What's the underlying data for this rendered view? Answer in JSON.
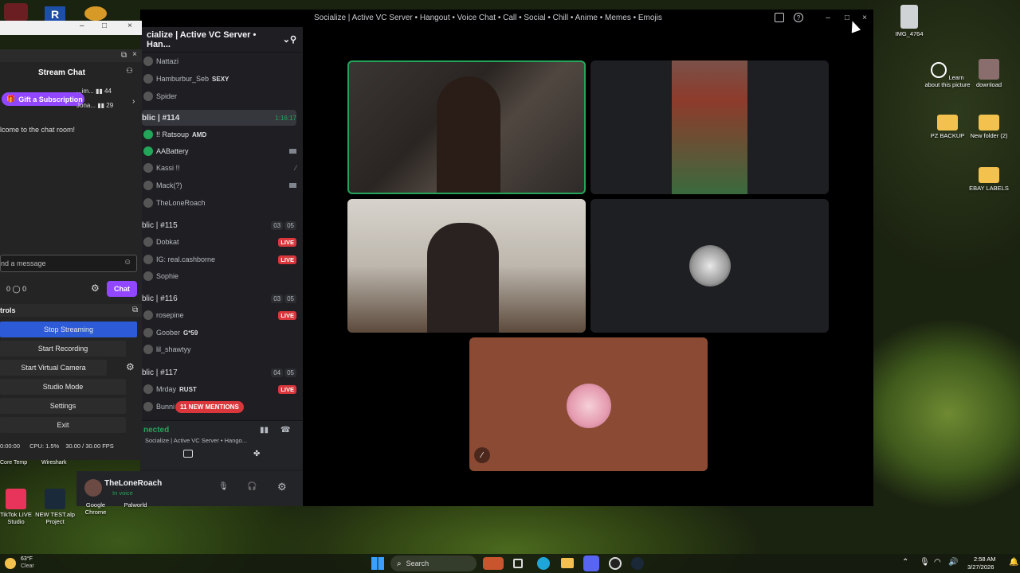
{
  "desktop": {
    "top_icons": [
      "IMG_4764"
    ],
    "right_icons": [
      {
        "label": "Learn about this picture"
      },
      {
        "label": "download"
      },
      {
        "label": "PZ BACKUP"
      },
      {
        "label": "New folder (2)"
      },
      {
        "label": "EBAY LABELS"
      }
    ],
    "bottom_icons": [
      {
        "label": "TikTok LIVE Studio"
      },
      {
        "label": "NEW TEST.alp Project"
      },
      {
        "label": "Google Chrome"
      },
      {
        "label": "Palworld"
      }
    ],
    "bottom_small_labels": [
      "Core Temp",
      "Wireshark"
    ]
  },
  "discord": {
    "window_title": "Socialize | Active VC Server • Hangout • Voice Chat • Call • Social • Chill • Anime • Memes • Emojis",
    "server_name": "cialize | Active VC Server • Han...",
    "top_users": [
      "Nattazi",
      "Hamburbur_Seb",
      "Spider"
    ],
    "top_user_tag": "SEXY",
    "channel_114": {
      "name": "blic | #114",
      "timer": "1:16:17"
    },
    "users_114": [
      {
        "name": "!! Ratsoup",
        "tag": "AMD"
      },
      {
        "name": "AABattery",
        "tag": ""
      },
      {
        "name": "Kassi !!",
        "tag": ""
      },
      {
        "name": "Mack(?)",
        "tag": ""
      },
      {
        "name": "TheLoneRoach",
        "tag": ""
      }
    ],
    "channel_115": {
      "name": "blic | #115",
      "count_a": "03",
      "count_b": "05"
    },
    "users_115": [
      {
        "name": "Dobkat",
        "tag": ""
      },
      {
        "name": "IG: real.cashborne",
        "tag": ""
      },
      {
        "name": "Sophie",
        "tag": ""
      }
    ],
    "channel_116": {
      "name": "blic | #116",
      "count_a": "03",
      "count_b": "05"
    },
    "users_116": [
      {
        "name": "rosepine",
        "tag": ""
      },
      {
        "name": "Goober",
        "tag": "G*59"
      },
      {
        "name": "lil_shawtyy",
        "tag": ""
      }
    ],
    "channel_117": {
      "name": "blic | #117",
      "count_a": "04",
      "count_b": "05"
    },
    "users_117": [
      {
        "name": "Mrday",
        "tag": "RUST"
      },
      {
        "name": "Bunni",
        "tag": ""
      }
    ],
    "live_label": "LIVE",
    "mentions_pill": "11 NEW MENTIONS",
    "connection": {
      "status": "nected",
      "sub": "Socialize | Active VC Server • Hango..."
    },
    "user": {
      "name": "TheLoneRoach",
      "status": "In voice"
    }
  },
  "obs": {
    "chat_title": "Stream Chat",
    "gift_button": "Gift a Subscription",
    "top_chatters": [
      {
        "name": "...im...",
        "count": "44"
      },
      {
        "name": "Jona...",
        "count": "29"
      }
    ],
    "welcome": "lcome to the chat room!",
    "message_placeholder": "nd a message",
    "points_a": "0",
    "points_b": "0",
    "chat_button": "Chat",
    "controls_header": "trols",
    "controls": [
      "Stop Streaming",
      "Start Recording",
      "Start Virtual Camera",
      "Studio Mode",
      "Settings",
      "Exit"
    ],
    "status_time": "0:00:00",
    "cpu": "CPU: 1.5%",
    "fps": "30.00 / 30.00 FPS"
  },
  "taskbar": {
    "weather_temp": "63°F",
    "weather_desc": "Clear",
    "search_label": "Search",
    "time": "2:58 AM",
    "date": "3/27/2026"
  },
  "colors": {
    "live_red": "#da373c",
    "obs_active": "#2d5bd7",
    "twitch_purple": "#9146ff",
    "discord_green": "#23a55a"
  }
}
